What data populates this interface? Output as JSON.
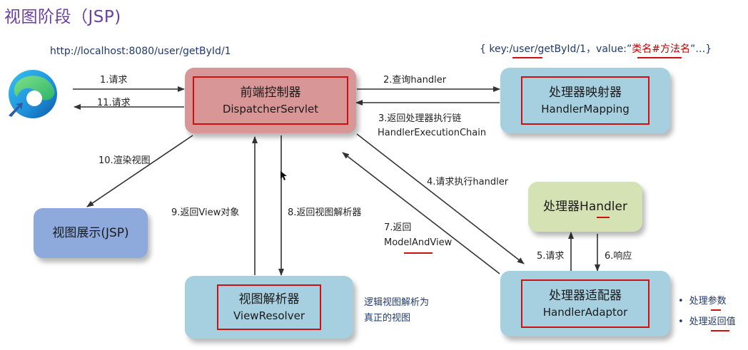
{
  "title": "视图阶段（JSP)",
  "url": "http://localhost:8080/user/getById/1",
  "key_info": {
    "prefix": "{ key:/",
    "path": "user/getById",
    "mid": "/1，value:”",
    "value": "类名#方法名",
    "suffix": "”…}"
  },
  "nodes": {
    "browser": {
      "icon": "edge-browser-icon"
    },
    "dispatcher": {
      "cn": "前端控制器",
      "en": "DispatcherServlet"
    },
    "mapping": {
      "cn": "处理器映射器",
      "en": "HandlerMapping"
    },
    "handler": {
      "cn": "处理器Handler"
    },
    "adaptor": {
      "cn": "处理器适配器",
      "en": "HandlerAdaptor"
    },
    "resolver": {
      "cn": "视图解析器",
      "en": "ViewResolver"
    },
    "view": {
      "cn": "视图展示(JSP)"
    }
  },
  "steps": {
    "s1": "1.请求",
    "s11": "11.请求",
    "s2": "2.查询handler",
    "s3a": "3.返回处理器执行链",
    "s3b": "HandlerExecutionChain",
    "s4": "4.请求执行handler",
    "s5": "5.请求",
    "s6": "6.响应",
    "s7a": "7.返回",
    "s7b": "ModelAndView",
    "s8": "8.返回视图解析器",
    "s9": "9.返回View对象",
    "s10": "10.渲染视图"
  },
  "resolver_note": {
    "line1": "逻辑视图解析为",
    "line2": "真正的视图"
  },
  "adaptor_bullets": [
    "处理参数",
    "处理返回值"
  ],
  "colors": {
    "dispatcher_fill": "#d99696",
    "blue_fill": "#a6cfe0",
    "green_fill": "#d5e3b4",
    "view_fill": "#8eaadc",
    "accent_red": "#d01010",
    "title_purple": "#6a3fa0"
  }
}
